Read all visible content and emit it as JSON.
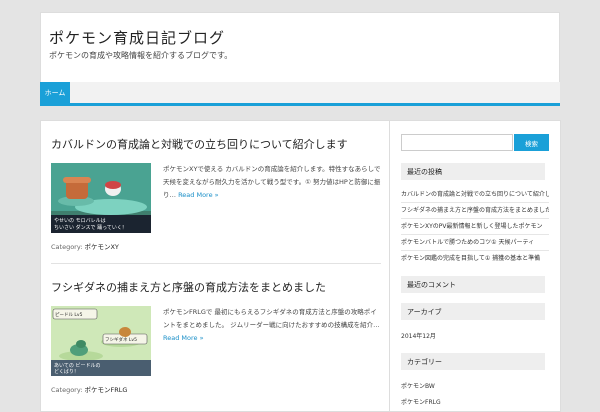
{
  "site": {
    "title": "ポケモン育成日記ブログ",
    "description": "ポケモンの育成や攻略情報を紹介するブログです。"
  },
  "nav": {
    "home_label": "ホーム"
  },
  "posts": [
    {
      "title": "カバルドンの育成論と対戦での立ち回りについて紹介します",
      "excerpt": "ポケモンXYで使える カバルドンの育成論を紹介します。特性すなあらしで天候を変えながら耐久力を活かして戦う型です。① 努力値はHPと防御に",
      "ellipsis": "振り… ",
      "read_more": "Read More »",
      "category_label": "Category: ",
      "category": "ポケモンXY",
      "thumb_caption_1": "やせいの モロバレルは",
      "thumb_caption_2": "ちいさい ダンスで 踊っていく！"
    },
    {
      "title": "フシギダネの捕まえ方と序盤の育成方法をまとめました",
      "excerpt": "ポケモンFRLGで 最初にもらえるフシギダネの育成方法と序盤の攻略ポイントをまとめました。 ジムリーダー戦に向けたおすすめの技構成を",
      "ellipsis": "紹介… ",
      "read_more": "Read More »",
      "category_label": "Category: ",
      "category": "ポケモンFRLG",
      "hud_top": "ピードル Lv5",
      "hud_bottom": "フシギダネ Lv5",
      "thumb_caption_1": "あいての ビードルの",
      "thumb_caption_2": "どくばり！"
    }
  ],
  "sidebar": {
    "search_button": "検索",
    "recent_title": "最近の投稿",
    "recent": [
      "カバルドンの育成論と対戦での立ち回りについて紹介します",
      "フシギダネの捕まえ方と序盤の育成方法をまとめました",
      "ポケモンXYのPV最新情報と新しく登場したポケモン",
      "ポケモンバトルで勝つためのコツ① 天候パーティ",
      "ポケモン図鑑の完成を目指して① 捕獲の基本と準備"
    ],
    "comments_title": "最近のコメント",
    "archive_title": "アーカイブ",
    "archive_month": "2014年12月",
    "category_title": "カテゴリー",
    "categories": [
      "ポケモンBW",
      "ポケモンFRLG"
    ]
  },
  "colors": {
    "accent": "#1aa0d8"
  }
}
